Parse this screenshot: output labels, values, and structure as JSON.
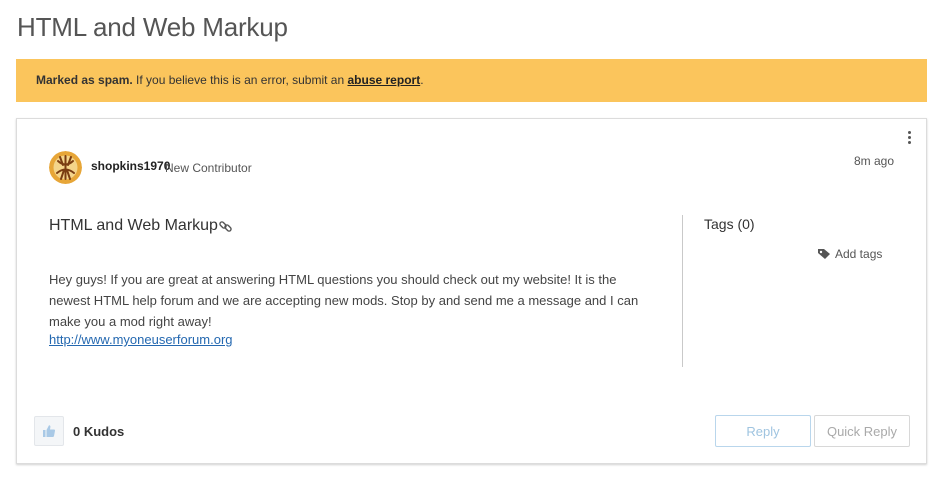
{
  "page": {
    "title": "HTML and Web Markup"
  },
  "banner": {
    "bold": "Marked as spam.",
    "text": " If you believe this is an error, submit an ",
    "link": "abuse report",
    "end": ".",
    "color": "#fbc55c"
  },
  "post": {
    "author": "shopkins1970",
    "rank": "New Contributor",
    "time": "8m ago",
    "subject": "HTML and Web Markup",
    "body": "Hey guys! If you are great at answering HTML questions you should check out my website! It is the newest HTML help forum and we are accepting new mods. Stop by and send me a message and I can make you a mod right away!",
    "link": "http://www.myoneuserforum.org",
    "options_icon": "kebab-icon",
    "permalink_icon": "link-icon"
  },
  "tags": {
    "title": "Tags (0)",
    "add_label": "Add tags",
    "icon": "tag-icon"
  },
  "footer": {
    "kudos": "0 Kudos",
    "kudo_icon": "thumbs-up-icon",
    "reply_label": "Reply",
    "quick_reply_label": "Quick Reply"
  }
}
